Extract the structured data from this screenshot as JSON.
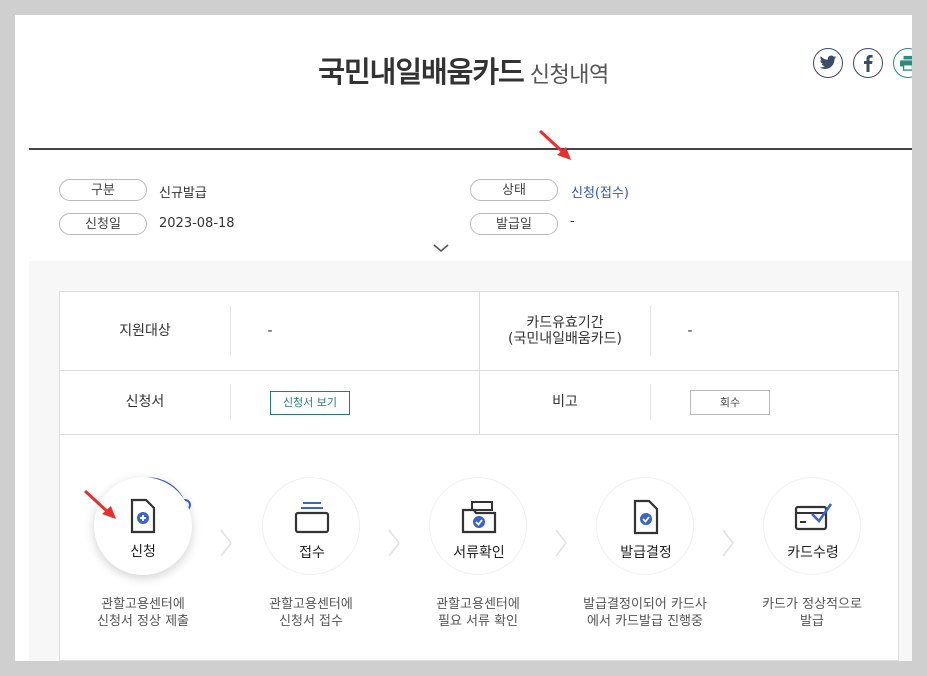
{
  "header": {
    "title": "국민내일배움카드",
    "subtitle": "신청내역"
  },
  "share": [
    {
      "icon": "twitter-icon",
      "color": "#3b4b6b"
    },
    {
      "icon": "facebook-icon",
      "color": "#3b4b6b"
    },
    {
      "icon": "print-icon",
      "color": "#2b8a7f"
    }
  ],
  "summary": {
    "category_label": "구분",
    "category_value": "신규발급",
    "status_label": "상태",
    "status_value": "신청(접수)",
    "apply_date_label": "신청일",
    "apply_date_value": "2023-08-18",
    "issue_date_label": "발급일",
    "issue_date_value": "-"
  },
  "detail": {
    "support_label": "지원대상",
    "support_value": "-",
    "validity_label_line1": "카드유효기간",
    "validity_label_line2": "(국민내일배움카드)",
    "validity_value": "-",
    "application_label": "신청서",
    "view_application_button": "신청서 보기",
    "remark_label": "비고",
    "withdraw_button": "회수"
  },
  "steps": [
    {
      "label": "신청",
      "desc_line1": "관할고용센터에",
      "desc_line2": "신청서 정상 제출",
      "active": true
    },
    {
      "label": "접수",
      "desc_line1": "관할고용센터에",
      "desc_line2": "신청서 접수",
      "active": false
    },
    {
      "label": "서류확인",
      "desc_line1": "관할고용센터에",
      "desc_line2": "필요 서류 확인",
      "active": false
    },
    {
      "label": "발급결정",
      "desc_line1": "발급결정이되어 카드사",
      "desc_line2": "에서 카드발급 진행중",
      "active": false
    },
    {
      "label": "카드수령",
      "desc_line1": "카드가 정상적으로",
      "desc_line2": "발급",
      "active": false
    }
  ],
  "colors": {
    "accent_blue": "#2f5aa8",
    "teal": "#2b7b74",
    "annotation_red": "#e53030"
  }
}
